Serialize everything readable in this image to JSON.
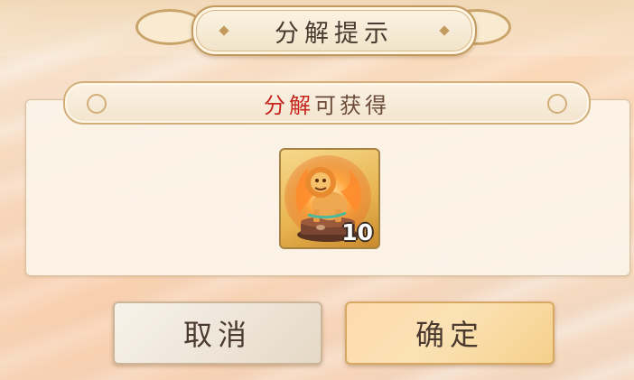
{
  "dialog": {
    "title": "分解提示",
    "subtitle_highlight": "分解",
    "subtitle_rest": "可获得",
    "reward_item": {
      "icon": "lion-statue-icon",
      "count": "10"
    },
    "cancel_label": "取消",
    "confirm_label": "确定"
  },
  "colors": {
    "highlight_red": "#c4261d",
    "text_brown": "#4a3a30",
    "gold_border": "#c29a5e"
  }
}
